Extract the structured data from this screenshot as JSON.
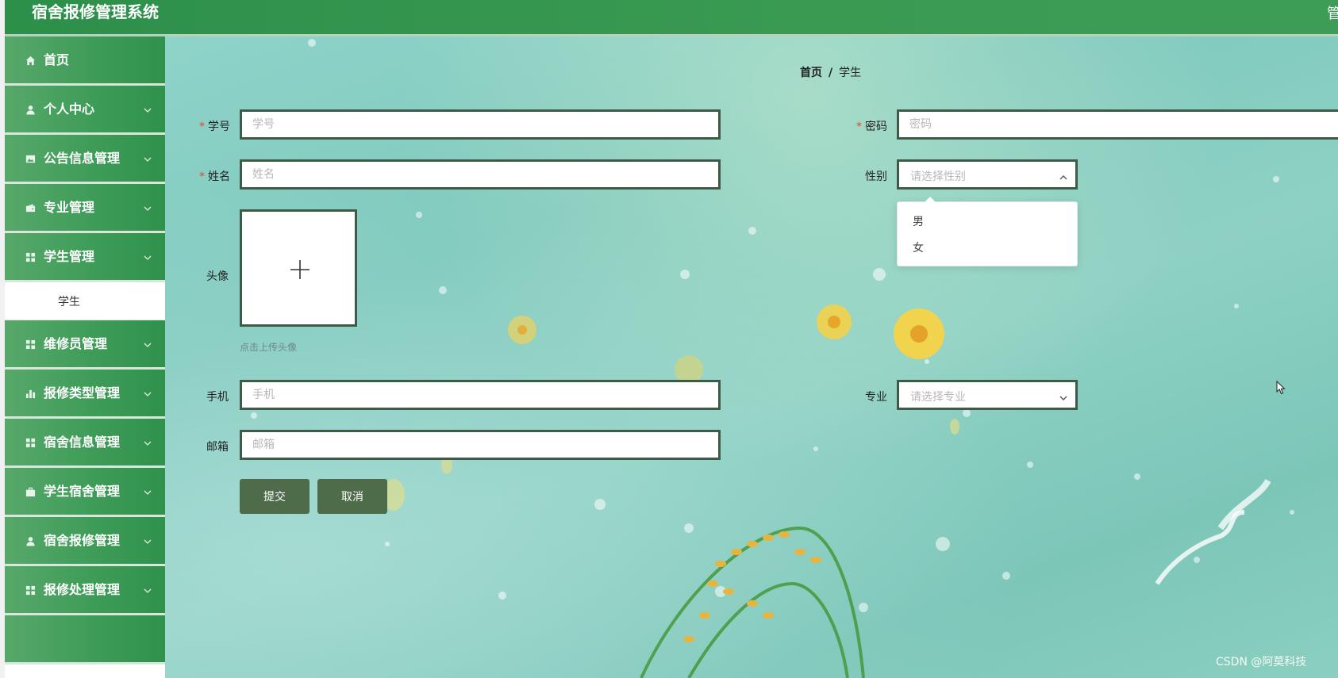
{
  "header": {
    "title": "宿舍报修管理系统",
    "user": "管"
  },
  "sidebar": {
    "items": [
      {
        "label": "首页",
        "icon": "home-icon",
        "has_children": false
      },
      {
        "label": "个人中心",
        "icon": "user-icon",
        "has_children": true
      },
      {
        "label": "公告信息管理",
        "icon": "picture-icon",
        "has_children": true
      },
      {
        "label": "专业管理",
        "icon": "wallet-icon",
        "has_children": true
      },
      {
        "label": "学生管理",
        "icon": "grid-icon",
        "has_children": true,
        "expanded": true
      },
      {
        "label": "维修员管理",
        "icon": "grid-icon",
        "has_children": true
      },
      {
        "label": "报修类型管理",
        "icon": "bar-chart-icon",
        "has_children": true
      },
      {
        "label": "宿舍信息管理",
        "icon": "grid-icon",
        "has_children": true
      },
      {
        "label": "学生宿舍管理",
        "icon": "briefcase-icon",
        "has_children": true
      },
      {
        "label": "宿舍报修管理",
        "icon": "user-icon",
        "has_children": true
      },
      {
        "label": "报修处理管理",
        "icon": "grid-icon",
        "has_children": true
      }
    ],
    "submenu": {
      "label": "学生"
    }
  },
  "breadcrumb": {
    "home": "首页",
    "separator": "/",
    "current": "学生"
  },
  "form": {
    "student_id": {
      "label": "学号",
      "required": true,
      "placeholder": "学号",
      "value": ""
    },
    "password": {
      "label": "密码",
      "required": true,
      "placeholder": "密码",
      "value": ""
    },
    "name": {
      "label": "姓名",
      "required": true,
      "placeholder": "姓名",
      "value": ""
    },
    "gender": {
      "label": "性别",
      "placeholder": "请选择性别",
      "open": true,
      "options": [
        "男",
        "女"
      ]
    },
    "avatar": {
      "label": "头像",
      "tip": "点击上传头像"
    },
    "phone": {
      "label": "手机",
      "placeholder": "手机",
      "value": ""
    },
    "major": {
      "label": "专业",
      "placeholder": "请选择专业",
      "open": false
    },
    "email": {
      "label": "邮箱",
      "placeholder": "邮箱",
      "value": ""
    },
    "submit_label": "提交",
    "cancel_label": "取消"
  },
  "watermark": "CSDN @阿莫科技",
  "colors": {
    "header_green": "#3a9a52",
    "menu_green": "#3e9c58",
    "input_border": "#3f5a46",
    "button_bg": "#4e6b4a",
    "required_star": "#e0462f",
    "background_teal": "#8fd3c9"
  }
}
